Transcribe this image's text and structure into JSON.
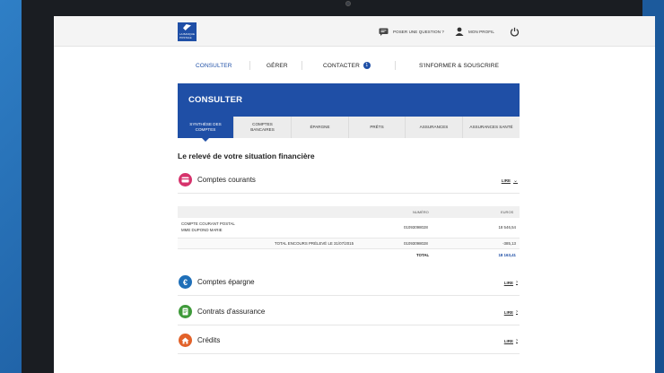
{
  "topbar": {
    "logo_text": "LA BANQUE POSTALE",
    "question_label": "POSER UNE QUESTION ?",
    "profile_label": "MON PROFIL"
  },
  "nav": {
    "items": [
      "CONSULTER",
      "GÉRER",
      "CONTACTER",
      "S'INFORMER & SOUSCRIRE"
    ],
    "contact_badge": "1"
  },
  "section": {
    "title": "CONSULTER",
    "tabs": [
      "SYNTHÈSE DES COMPTES",
      "COMPTES BANCAIRES",
      "ÉPARGNE",
      "PRÊTS",
      "ASSURANCES",
      "ASSURANCES SANTÉ"
    ]
  },
  "page_title": "Le relevé de votre situation financière",
  "categories": [
    {
      "label": "Comptes courants",
      "action": "LIRE",
      "icon": "card-icon",
      "color": "#d6336c"
    },
    {
      "label": "Comptes épargne",
      "action": "LIRE",
      "icon": "euro-icon",
      "color": "#1f6fb8"
    },
    {
      "label": "Contrats d'assurance",
      "action": "LIRE",
      "icon": "document-icon",
      "color": "#3f9a3a"
    },
    {
      "label": "Crédits",
      "action": "LIRE",
      "icon": "home-icon",
      "color": "#e2622a"
    }
  ],
  "accounts_table": {
    "columns": [
      "NUMÉRO",
      "EUROS"
    ],
    "rows": [
      {
        "label_1": "COMPTE COURANT POSTAL",
        "label_2": "MME DUPOND MARIE",
        "numero": "01093098028",
        "euros": "18 546,54"
      },
      {
        "label_1": "TOTAL ENCOURS PRÉLEVÉ LE 31/07/2015",
        "numero": "01093098028",
        "euros": "-385,13"
      }
    ],
    "total_label": "TOTAL",
    "total_value": "18 163,41"
  }
}
